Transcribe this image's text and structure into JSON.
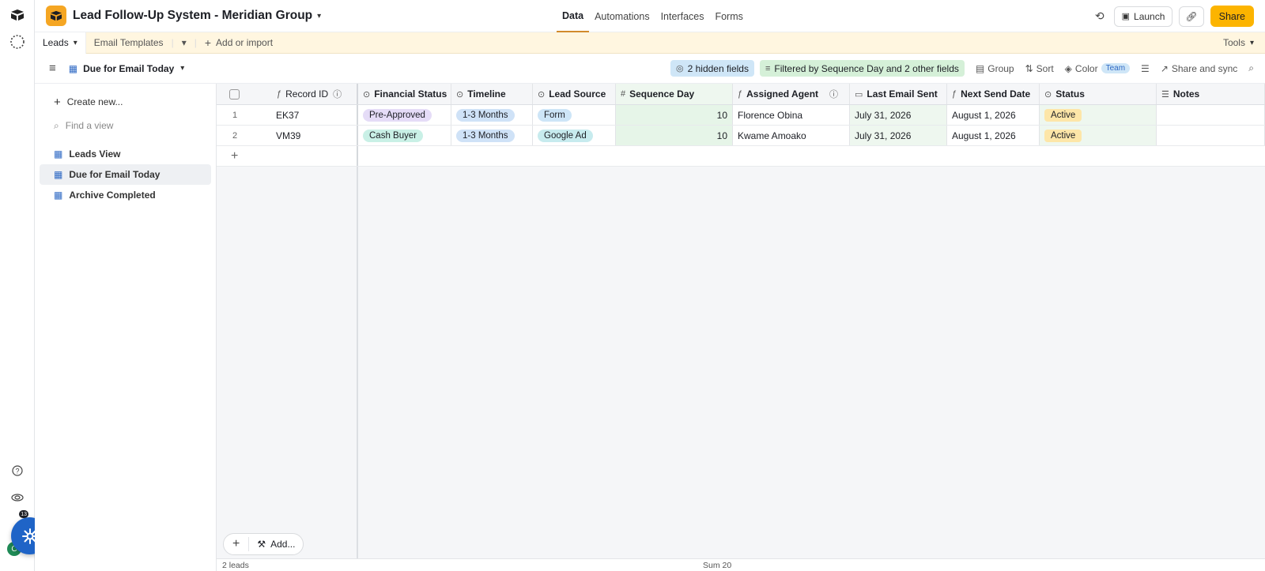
{
  "base": {
    "title": "Lead Follow-Up System - Meridian Group"
  },
  "nav": {
    "tabs": [
      "Data",
      "Automations",
      "Interfaces",
      "Forms"
    ]
  },
  "top_actions": {
    "launch": "Launch",
    "share": "Share"
  },
  "tables": {
    "active": "Leads",
    "other": "Email Templates",
    "add": "Add or import",
    "tools": "Tools"
  },
  "view": {
    "name": "Due for Email Today",
    "hidden_fields": "2 hidden fields",
    "filter": "Filtered by Sequence Day and 2 other fields",
    "group": "Group",
    "sort": "Sort",
    "color": "Color",
    "color_tag": "Team",
    "share_sync": "Share and sync"
  },
  "sidebar": {
    "create": "Create new...",
    "find_placeholder": "Find a view",
    "views": [
      "Leads View",
      "Due for Email Today",
      "Archive Completed"
    ]
  },
  "grid": {
    "columns": [
      "Record ID",
      "Financial Status",
      "Timeline",
      "Lead Source",
      "Sequence Day",
      "Assigned Agent",
      "Last Email Sent",
      "Next Send Date",
      "Status",
      "Notes"
    ],
    "rows": [
      {
        "num": "1",
        "record_id": "EK37",
        "financial": "Pre-Approved",
        "timeline": "1-3 Months",
        "source": "Form",
        "seq": "10",
        "agent": "Florence Obina",
        "last_sent": "July 31, 2026",
        "next_send": "August 1, 2026",
        "status": "Active"
      },
      {
        "num": "2",
        "record_id": "VM39",
        "financial": "Cash Buyer",
        "timeline": "1-3 Months",
        "source": "Google Ad",
        "seq": "10",
        "agent": "Kwame Amoako",
        "last_sent": "July 31, 2026",
        "next_send": "August 1, 2026",
        "status": "Active"
      }
    ]
  },
  "footer": {
    "count": "2 leads",
    "sum": "Sum 20",
    "add": "Add..."
  },
  "badge": {
    "notifications": "13"
  },
  "colors": {
    "accent": "#fcb400",
    "filter_bg": "#d5f0d8",
    "hidden_bg": "#cfe6f7",
    "seq_bg": "#e6f5e8"
  }
}
